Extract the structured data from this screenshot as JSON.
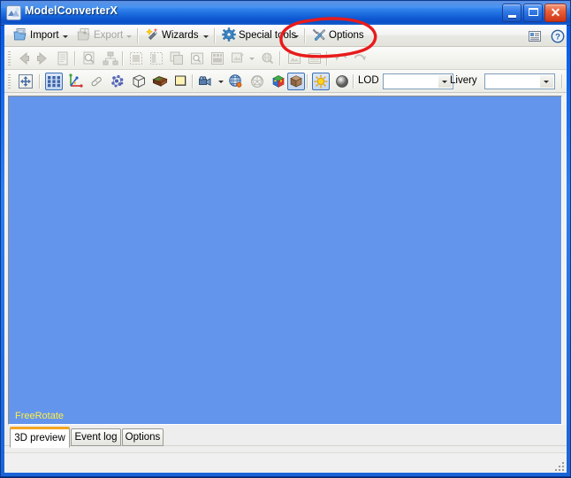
{
  "window": {
    "title": "ModelConverterX",
    "app_icon": "app-cube-icon",
    "caption_buttons": [
      {
        "name": "minimize",
        "glyph": "_"
      },
      {
        "name": "maximize",
        "glyph": "□"
      },
      {
        "name": "close",
        "glyph": "✕"
      }
    ],
    "colors": {
      "titlebar_blue": "#2b7ff2",
      "frame_blue": "#0a4ec8",
      "close_red": "#cf3416",
      "viewport_blue": "#6495ed",
      "overlay_text_yellow": "#ffee44",
      "annotation_red": "#e81b1b",
      "active_tab_accent": "#f5a623",
      "toolbar_face": "#f3f3ef",
      "checked_button_border": "#3c6fb4"
    }
  },
  "menubar": {
    "items": [
      {
        "label": "Import",
        "icon": "import-folder-icon",
        "enabled": true,
        "has_dropdown": true
      },
      {
        "label": "Export",
        "icon": "export-disk-icon",
        "enabled": false,
        "has_dropdown": true
      },
      {
        "label": "Wizards",
        "icon": "magic-wand-icon",
        "enabled": true,
        "has_dropdown": true
      },
      {
        "label": "Special tools",
        "icon": "gear-icon",
        "enabled": true,
        "has_dropdown": true
      },
      {
        "label": "Options",
        "icon": "wrench-screwdriver-icon",
        "enabled": true,
        "has_dropdown": false
      }
    ],
    "right_items": [
      {
        "name": "report-icon",
        "label": ""
      },
      {
        "name": "help-question-icon",
        "label": ""
      }
    ]
  },
  "toolbar_primary": {
    "buttons": [
      {
        "name": "back-arrow-icon",
        "enabled": false
      },
      {
        "name": "forward-arrow-icon",
        "enabled": false
      },
      {
        "name": "document-icon",
        "enabled": false
      },
      {
        "name": "zoom-document-icon",
        "enabled": false
      },
      {
        "name": "hierarchy-tree-icon",
        "enabled": false
      },
      {
        "name": "select-all-icon",
        "enabled": false
      },
      {
        "name": "select-partial-icon",
        "enabled": false
      },
      {
        "name": "copy-layers-icon",
        "enabled": false
      },
      {
        "name": "inspect-object-icon",
        "enabled": false
      },
      {
        "name": "crop-marks-icon",
        "enabled": false
      },
      {
        "name": "export-image-icon",
        "enabled": false,
        "has_dropdown": true
      },
      {
        "name": "search-globe-icon",
        "enabled": false
      },
      {
        "name": "picture-icon",
        "enabled": false
      },
      {
        "name": "list-report-icon",
        "enabled": false
      },
      {
        "name": "undo-icon",
        "enabled": false
      },
      {
        "name": "redo-icon",
        "enabled": false
      }
    ]
  },
  "toolbar_view": {
    "buttons": [
      {
        "name": "fit-to-view-icon",
        "checked": false
      },
      {
        "name": "grid-icon",
        "checked": true
      },
      {
        "name": "axis-icon",
        "checked": false
      },
      {
        "name": "eraser-icon",
        "checked": false
      },
      {
        "name": "vertices-icon",
        "checked": false
      },
      {
        "name": "wireframe-cube-icon",
        "checked": false
      },
      {
        "name": "texture-brick-icon",
        "checked": false
      },
      {
        "name": "flat-color-icon",
        "checked": false
      },
      {
        "name": "camera-icon",
        "checked": false,
        "has_dropdown": true
      },
      {
        "name": "mesh-sphere-icon",
        "checked": false
      },
      {
        "name": "polygon-sphere-icon",
        "checked": false
      },
      {
        "name": "color-cube-icon",
        "checked": false
      },
      {
        "name": "solid-box-icon",
        "checked": true
      },
      {
        "name": "light-sun-icon",
        "checked": true
      },
      {
        "name": "environment-sphere-icon",
        "checked": false
      }
    ],
    "lod": {
      "label": "LOD",
      "value": "",
      "options": []
    },
    "livery": {
      "label": "Livery",
      "value": "",
      "options": []
    }
  },
  "viewport": {
    "overlay_label": "FreeRotate"
  },
  "tabs": [
    {
      "label": "3D preview",
      "active": true
    },
    {
      "label": "Event log",
      "active": false
    },
    {
      "label": "Options",
      "active": false
    }
  ],
  "statusbar": {
    "text": "",
    "resize_grip": "resize-grip-icon"
  },
  "annotation": {
    "shape": "hand-drawn-ellipse",
    "target": "Options",
    "color": "#e81b1b"
  }
}
